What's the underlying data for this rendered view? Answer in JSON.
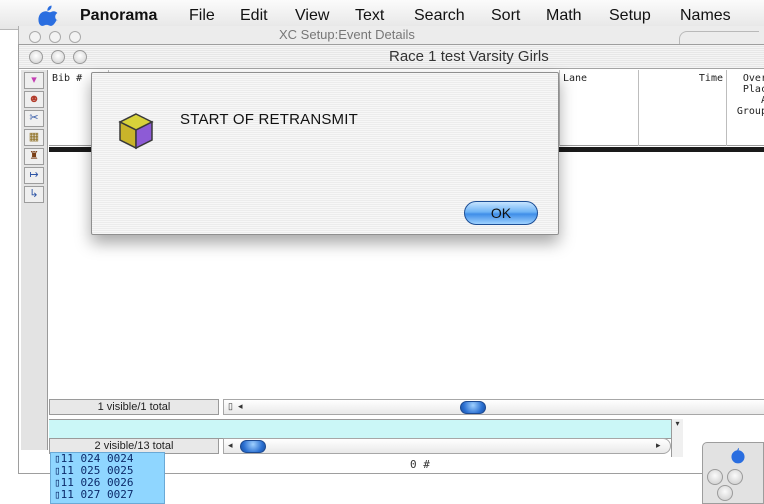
{
  "menubar": {
    "app_name": "Panorama",
    "items": [
      "File",
      "Edit",
      "View",
      "Text",
      "Search",
      "Sort",
      "Math",
      "Setup",
      "Names"
    ]
  },
  "back_window": {
    "title": "XC Setup:Event Details"
  },
  "main_window": {
    "title": "Race 1 test Varsity Girls"
  },
  "columns": [
    {
      "label": "Bib #"
    },
    {
      "label": "Lane"
    },
    {
      "label": "Time"
    },
    {
      "label": "Overa\nPlace\nAl\nGroups"
    }
  ],
  "status": {
    "top_count": "1 visible/1 total",
    "bottom_count": "2 visible/13 total"
  },
  "lower_list": {
    "rows": [
      "▯11 024 0024",
      "▯11 025 0025",
      "▯11 026 0026",
      "▯11 027 0027"
    ]
  },
  "lower_field": {
    "text": "0 #"
  },
  "alert": {
    "message": "START OF RETRANSMIT",
    "ok_label": "OK"
  },
  "colors": {
    "ok_button": "#5aa5f2",
    "list_bg": "#8fd6ff",
    "teal_strip": "#cbf7f7"
  },
  "icons": {
    "alert": "cube-icon",
    "menu": "apple-icon"
  }
}
